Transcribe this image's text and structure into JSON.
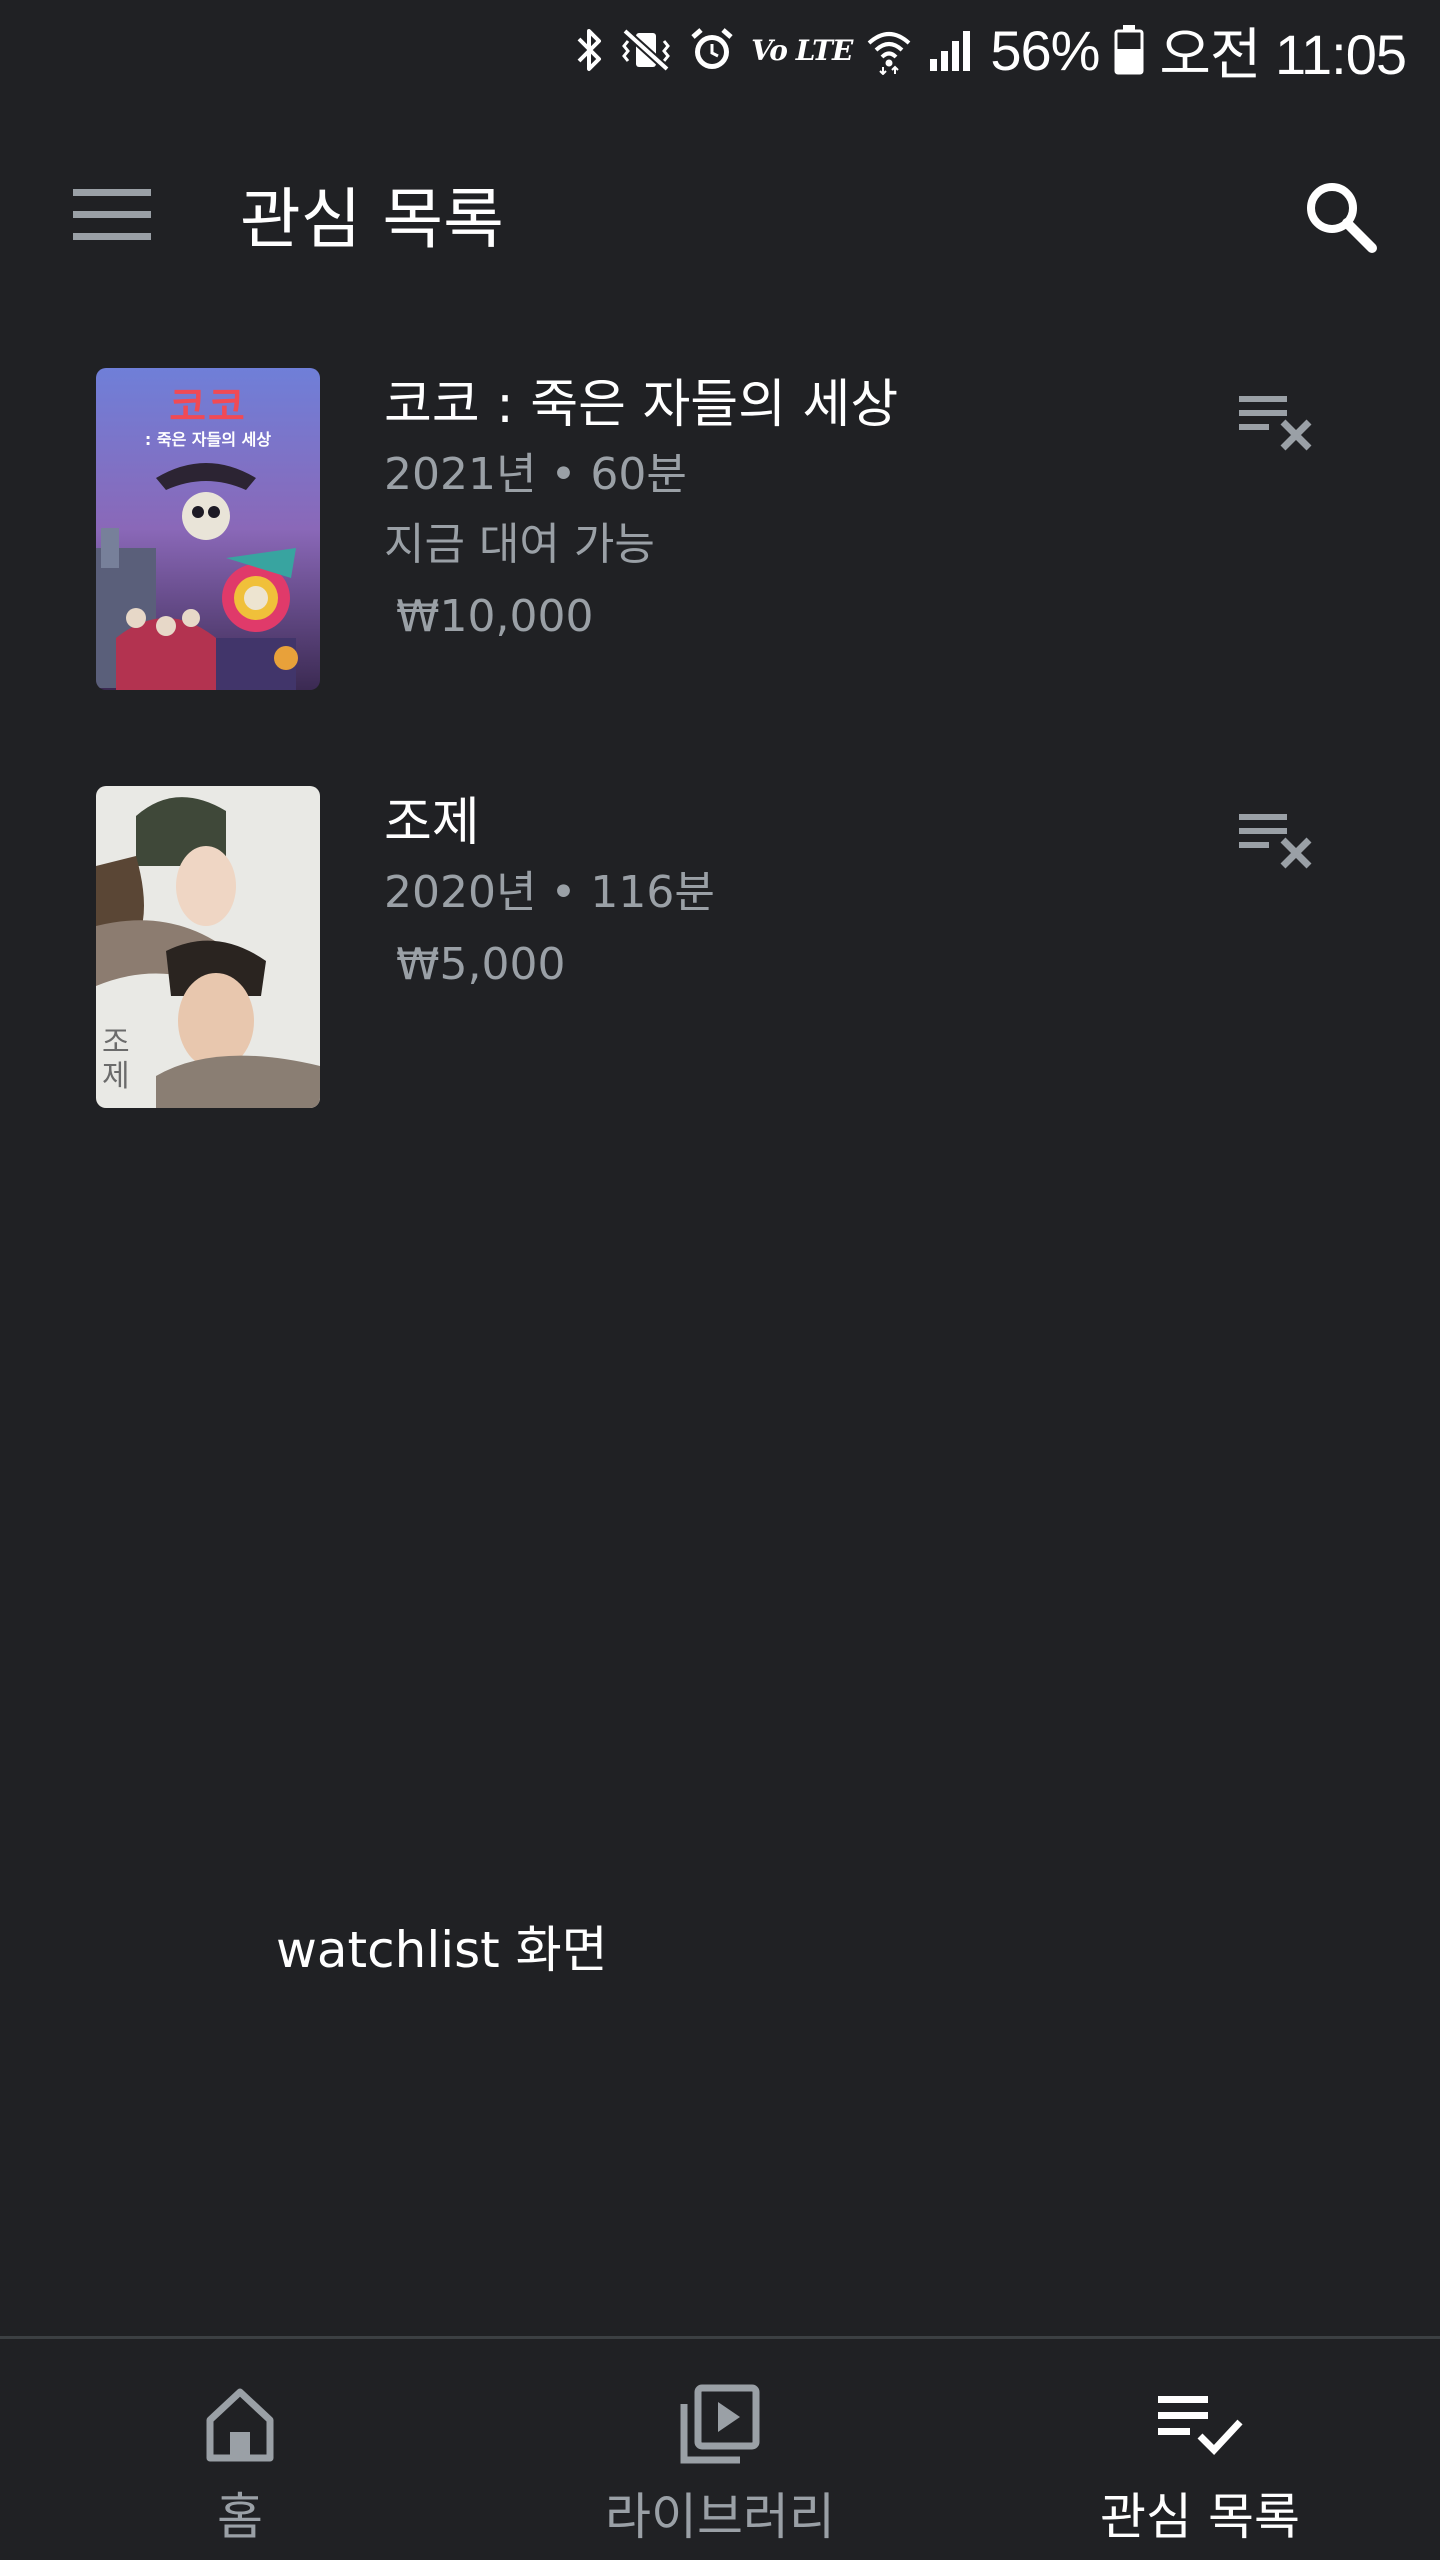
{
  "status_bar": {
    "volte": "Vo LTE",
    "battery": "56%",
    "time": "오전 11:05"
  },
  "app_bar": {
    "title": "관심 목록",
    "menu_icon": "menu-icon",
    "search_icon": "search-icon"
  },
  "items": [
    {
      "title": "코코 : 죽은 자들의 세상",
      "meta": "2021년 • 60분",
      "availability": "지금 대여 가능",
      "price": "₩10,000",
      "poster_text": "코코",
      "poster_subtitle": ": 죽은 자들의 세상"
    },
    {
      "title": "조제",
      "meta": "2020년 • 116분",
      "price": "₩5,000",
      "poster_text": "조제"
    }
  ],
  "caption": "watchlist 화면",
  "bottom_nav": {
    "items": [
      {
        "label": "홈",
        "icon": "home-icon"
      },
      {
        "label": "라이브러리",
        "icon": "library-icon"
      },
      {
        "label": "관심 목록",
        "icon": "watchlist-icon"
      }
    ],
    "active_index": 2
  },
  "colors": {
    "background": "#202124",
    "secondary_text": "#9aa0a6",
    "primary_text": "#ffffff"
  }
}
